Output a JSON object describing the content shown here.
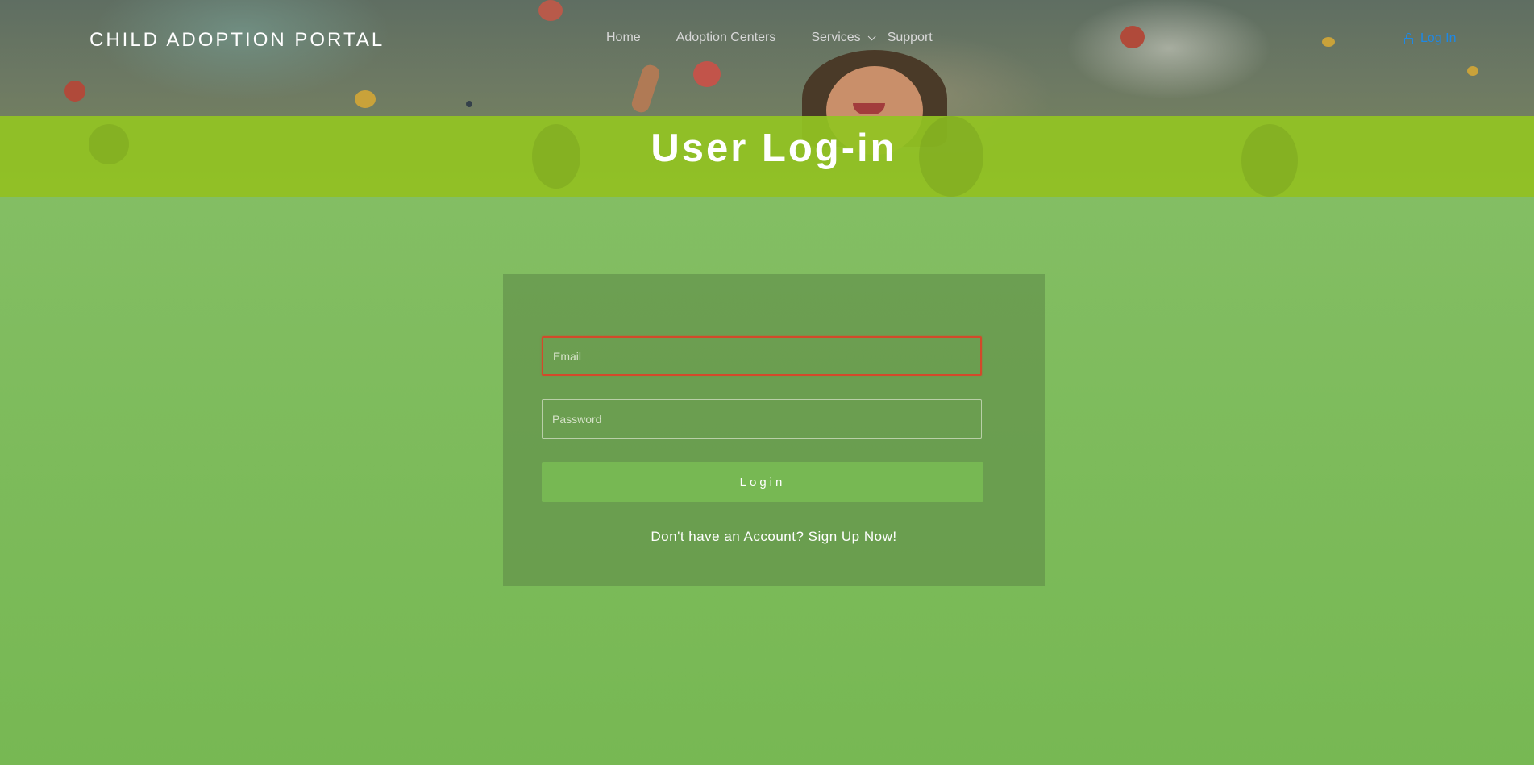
{
  "header": {
    "brand": "CHILD ADOPTION PORTAL",
    "nav": [
      {
        "label": "Home"
      },
      {
        "label": "Adoption Centers"
      },
      {
        "label": "Services",
        "has_dropdown": true
      },
      {
        "label": "Support"
      }
    ],
    "login_link": "Log In",
    "login_icon": "lock-icon"
  },
  "hero": {
    "title": "User Log-in"
  },
  "login_form": {
    "email_placeholder": "Email",
    "email_value": "",
    "password_placeholder": "Password",
    "password_value": "",
    "submit_label": "Login",
    "signup_text": "Don't have an Account? Sign Up Now!"
  },
  "colors": {
    "page_green": "#7dbb5b",
    "band_green": "#92c422",
    "button_green": "#77b853",
    "link_blue": "#1e88e5",
    "error_red": "#d24a2a"
  }
}
